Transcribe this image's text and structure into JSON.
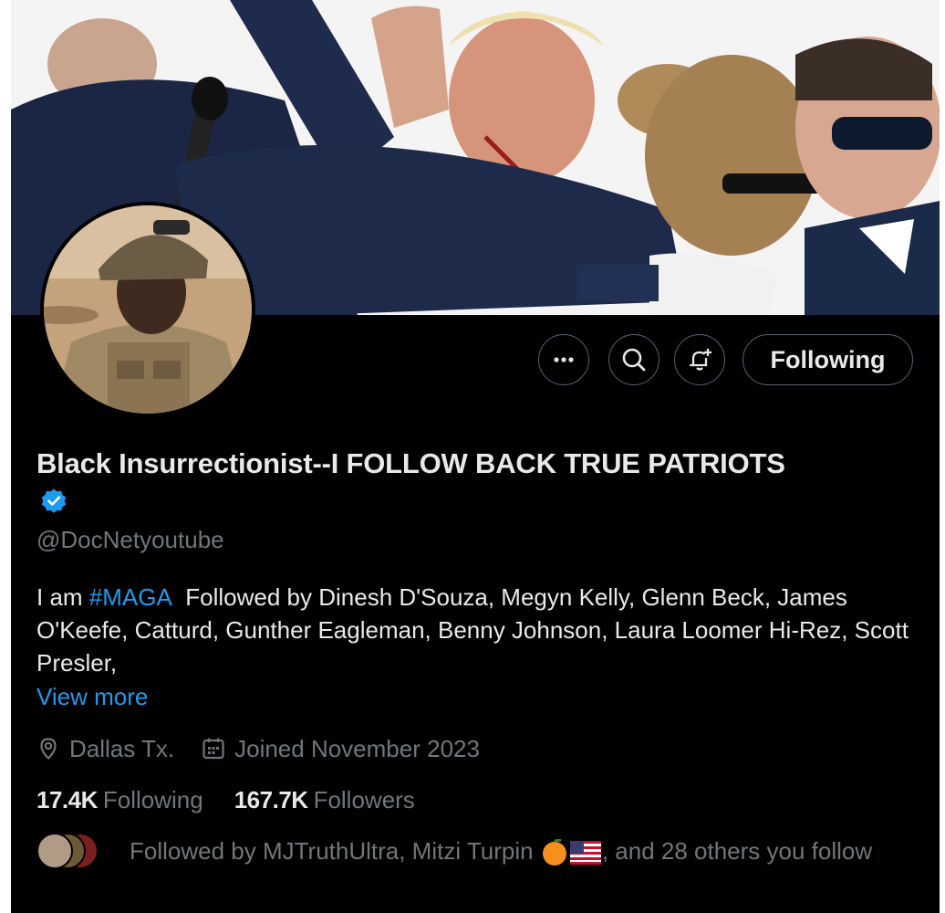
{
  "actions": {
    "more_icon": "more-icon",
    "search_icon": "search-icon",
    "notify_icon": "bell-plus-icon",
    "following_label": "Following"
  },
  "profile": {
    "display_name": "Black Insurrectionist--I FOLLOW BACK TRUE PATRIOTS",
    "verified_icon": "verified-badge-icon",
    "handle": "@DocNetyoutube",
    "bio_prefix": "I am ",
    "bio_hashtag": "#MAGA",
    "bio_rest": "Followed by Dinesh D'Souza, Megyn Kelly, Glenn Beck, James O'Keefe, Catturd, Gunther Eagleman, Benny Johnson, Laura Loomer Hi-Rez, Scott Presler,",
    "view_more": "View more",
    "location": "Dallas Tx.",
    "joined": "Joined November 2023"
  },
  "stats": {
    "following_count": "17.4K",
    "following_label": "Following",
    "followers_count": "167.7K",
    "followers_label": "Followers"
  },
  "followed_by": {
    "prefix": "Followed by MJTruthUltra, Mitzi Turpin ",
    "suffix": ", and 28 others you follow",
    "emojis": [
      "orange-circle-emoji",
      "us-flag-emoji"
    ]
  },
  "colors": {
    "background": "#000000",
    "primary_text": "#e7e9ea",
    "secondary_text": "#71767b",
    "accent": "#1d9bf0"
  }
}
